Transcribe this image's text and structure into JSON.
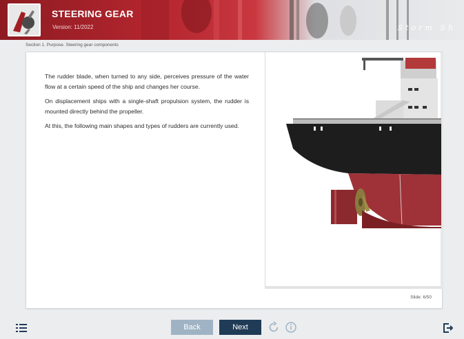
{
  "header": {
    "title": "STEERING GEAR",
    "version": "Version: 11/2022",
    "brand": "Storm Sh"
  },
  "breadcrumb": "Section 1. Purpose. Steering gear components",
  "content": {
    "paragraphs": [
      "The rudder blade, when turned to any side, perceives pressure of the water flow at a certain speed of the ship and changes her course.",
      "On displacement ships with a single-shaft propulsion system, the rudder is mounted directly behind the propeller.",
      "At this, the following main shapes and types of rudders are currently used."
    ],
    "image": "ship-stern-illustration",
    "slide_counter": "Slide: 6/50"
  },
  "footer": {
    "back_label": "Back",
    "next_label": "Next",
    "menu_icon": "list-menu-icon",
    "reload_icon": "reload-icon",
    "info_icon": "info-icon",
    "exit_icon": "exit-icon"
  },
  "colors": {
    "header_red": "#b5262f",
    "next_button": "#1f3b56",
    "back_button": "#9fb3c4"
  }
}
